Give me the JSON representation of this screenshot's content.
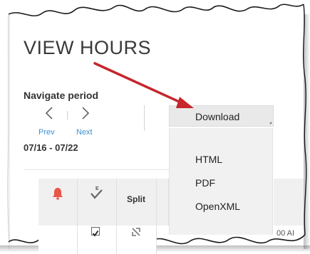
{
  "page": {
    "title": "VIEW HOURS"
  },
  "navigate": {
    "label": "Navigate period",
    "prev_label": "Prev",
    "next_label": "Next",
    "date_range": "07/16 - 07/22"
  },
  "download": {
    "button_label": "Download",
    "options": [
      "HTML",
      "PDF",
      "OpenXML"
    ]
  },
  "table": {
    "headers": [
      "",
      "",
      "Split"
    ],
    "partial_time_text": "00 AI"
  },
  "icons": {
    "alert": "bell-icon",
    "expense": "check-e-icon",
    "split": "split-icon",
    "prev": "chevron-left-icon",
    "next": "chevron-right-icon"
  },
  "colors": {
    "bell": "#e8574a",
    "link": "#3a8fd0",
    "arrow": "#c6262c",
    "button_bg": "#e9e9e9",
    "menu_bg": "#f1f1f1"
  }
}
